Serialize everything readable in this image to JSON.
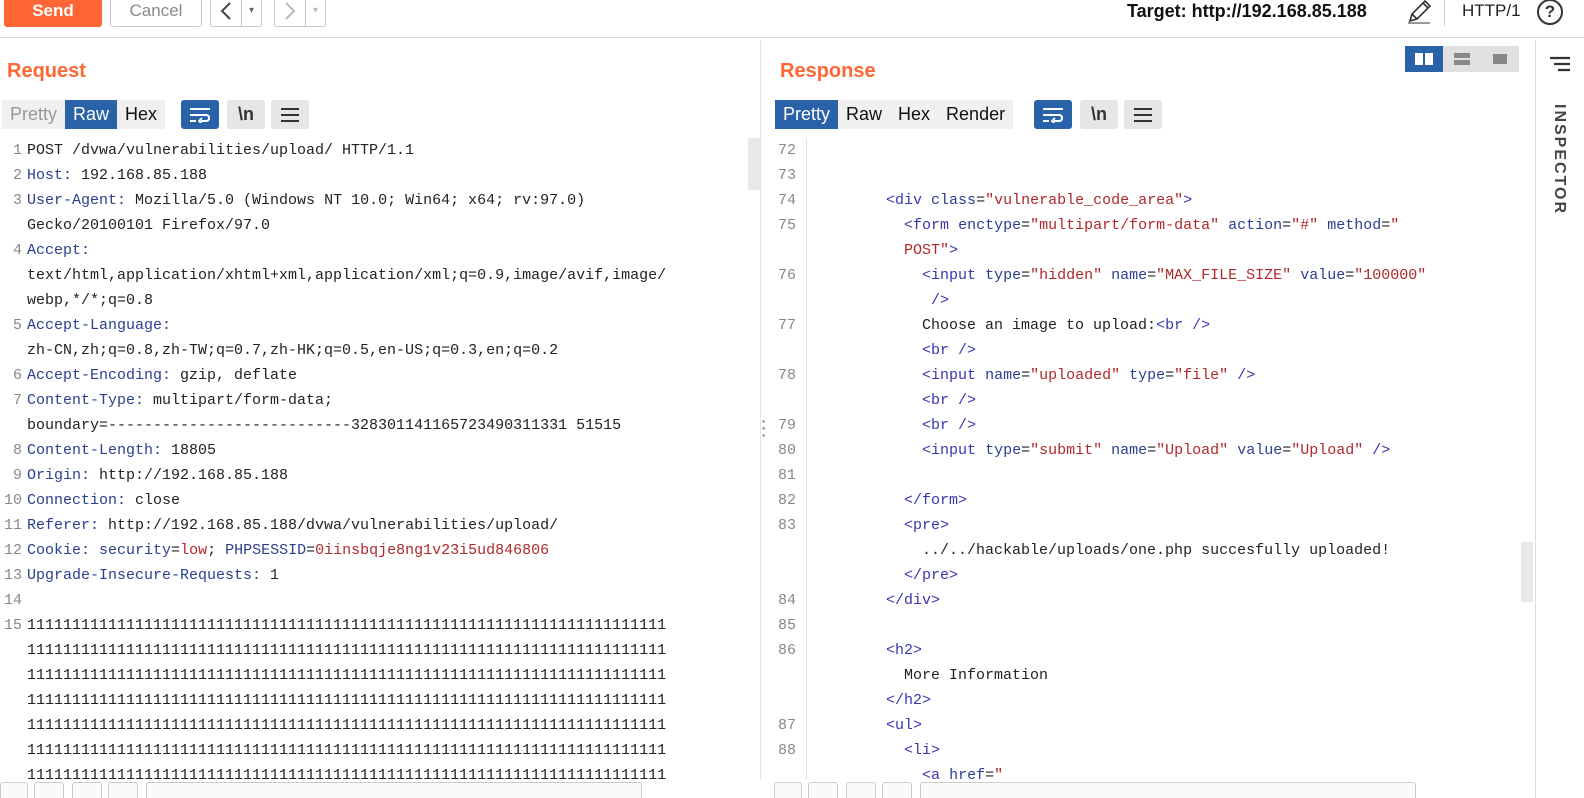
{
  "toolbar": {
    "send_label": "Send",
    "cancel_label": "Cancel",
    "back_glyph": "<",
    "forward_glyph": ">",
    "dropdown_glyph": "▾",
    "target": "Target: http://192.168.85.188",
    "protocol": "HTTP/1",
    "help_glyph": "?"
  },
  "icons": [
    "pencil-icon",
    "help-icon",
    "wrap-icon",
    "newline-icon",
    "menu-icon",
    "layout-split-icon",
    "layout-rows-icon",
    "layout-single-icon",
    "inspector-menu-icon"
  ],
  "colors": {
    "accent": "#ff6633",
    "active_tab": "#2962a8"
  },
  "request": {
    "title": "Request",
    "tabs": [
      {
        "label": "Pretty",
        "active": false
      },
      {
        "label": "Raw",
        "active": true
      },
      {
        "label": "Hex",
        "active": false
      }
    ],
    "newline_label": "\\n",
    "lines": [
      {
        "n": "1",
        "segs": [
          [
            "",
            "POST /dvwa/vulnerabilities/upload/ HTTP/1.1"
          ]
        ]
      },
      {
        "n": "2",
        "segs": [
          [
            "hk",
            "Host:"
          ],
          [
            "",
            " 192.168.85.188"
          ]
        ]
      },
      {
        "n": "3",
        "segs": [
          [
            "hk",
            "User-Agent:"
          ],
          [
            "",
            " Mozilla/5.0 (Windows NT 10.0; Win64; x64; rv:97.0)"
          ]
        ]
      },
      {
        "n": "",
        "segs": [
          [
            "",
            "Gecko/20100101 Firefox/97.0"
          ]
        ]
      },
      {
        "n": "4",
        "segs": [
          [
            "hk",
            "Accept:"
          ]
        ]
      },
      {
        "n": "",
        "segs": [
          [
            "",
            "text/html,application/xhtml+xml,application/xml;q=0.9,image/avif,image/"
          ]
        ]
      },
      {
        "n": "",
        "segs": [
          [
            "",
            "webp,*/*;q=0.8"
          ]
        ]
      },
      {
        "n": "5",
        "segs": [
          [
            "hk",
            "Accept-Language:"
          ]
        ]
      },
      {
        "n": "",
        "segs": [
          [
            "",
            "zh-CN,zh;q=0.8,zh-TW;q=0.7,zh-HK;q=0.5,en-US;q=0.3,en;q=0.2"
          ]
        ]
      },
      {
        "n": "6",
        "segs": [
          [
            "hk",
            "Accept-Encoding:"
          ],
          [
            "",
            " gzip, deflate"
          ]
        ]
      },
      {
        "n": "7",
        "segs": [
          [
            "hk",
            "Content-Type:"
          ],
          [
            "",
            " multipart/form-data;"
          ]
        ]
      },
      {
        "n": "",
        "segs": [
          [
            "",
            "boundary=---------------------------328301141165723490311331 51515"
          ]
        ]
      },
      {
        "n": "8",
        "segs": [
          [
            "hk",
            "Content-Length:"
          ],
          [
            "",
            " 18805"
          ]
        ]
      },
      {
        "n": "9",
        "segs": [
          [
            "hk",
            "Origin:"
          ],
          [
            "",
            " http://192.168.85.188"
          ]
        ]
      },
      {
        "n": "10",
        "segs": [
          [
            "hk",
            "Connection:"
          ],
          [
            "",
            " close"
          ]
        ]
      },
      {
        "n": "11",
        "segs": [
          [
            "hk",
            "Referer:"
          ],
          [
            "",
            " http://192.168.85.188/dvwa/vulnerabilities/upload/"
          ]
        ]
      },
      {
        "n": "12",
        "segs": [
          [
            "hk",
            "Cookie:"
          ],
          [
            "",
            " "
          ],
          [
            "ck",
            "security"
          ],
          [
            "",
            "="
          ],
          [
            "cv",
            "low"
          ],
          [
            "",
            "; "
          ],
          [
            "ck",
            "PHPSESSID"
          ],
          [
            "",
            "="
          ],
          [
            "cv",
            "0iinsbqje8ng1v23i5ud846806"
          ]
        ]
      },
      {
        "n": "13",
        "segs": [
          [
            "hk",
            "Upgrade-Insecure-Requests:"
          ],
          [
            "",
            " 1"
          ]
        ]
      },
      {
        "n": "14",
        "segs": [
          [
            "",
            ""
          ]
        ]
      },
      {
        "n": "15",
        "segs": [
          [
            "",
            "11111111111111111111111111111111111111111111111111111111111111111111111"
          ]
        ]
      },
      {
        "n": "",
        "segs": [
          [
            "",
            "11111111111111111111111111111111111111111111111111111111111111111111111"
          ]
        ]
      },
      {
        "n": "",
        "segs": [
          [
            "",
            "11111111111111111111111111111111111111111111111111111111111111111111111"
          ]
        ]
      },
      {
        "n": "",
        "segs": [
          [
            "",
            "11111111111111111111111111111111111111111111111111111111111111111111111"
          ]
        ]
      },
      {
        "n": "",
        "segs": [
          [
            "",
            "11111111111111111111111111111111111111111111111111111111111111111111111"
          ]
        ]
      },
      {
        "n": "",
        "segs": [
          [
            "",
            "11111111111111111111111111111111111111111111111111111111111111111111111"
          ]
        ]
      },
      {
        "n": "",
        "segs": [
          [
            "",
            "11111111111111111111111111111111111111111111111111111111111111111111111"
          ]
        ]
      }
    ]
  },
  "response": {
    "title": "Response",
    "tabs": [
      {
        "label": "Pretty",
        "active": true
      },
      {
        "label": "Raw",
        "active": false
      },
      {
        "label": "Hex",
        "active": false
      },
      {
        "label": "Render",
        "active": false
      }
    ],
    "newline_label": "\\n",
    "lines": [
      {
        "n": "72",
        "segs": [
          [
            "",
            ""
          ]
        ]
      },
      {
        "n": "73",
        "segs": [
          [
            "",
            ""
          ]
        ]
      },
      {
        "n": "74",
        "segs": [
          [
            "",
            "          "
          ],
          [
            "tg",
            "<div"
          ],
          [
            "",
            " "
          ],
          [
            "an",
            "class"
          ],
          [
            "",
            "="
          ],
          [
            "av",
            "\"vulnerable_code_area\""
          ],
          [
            "tg",
            ">"
          ]
        ]
      },
      {
        "n": "75",
        "segs": [
          [
            "",
            "            "
          ],
          [
            "tg",
            "<form"
          ],
          [
            "",
            " "
          ],
          [
            "an",
            "enctype"
          ],
          [
            "",
            "="
          ],
          [
            "av",
            "\"multipart/form-data\""
          ],
          [
            "",
            " "
          ],
          [
            "an",
            "action"
          ],
          [
            "",
            "="
          ],
          [
            "av",
            "\"#\""
          ],
          [
            "",
            " "
          ],
          [
            "an",
            "method"
          ],
          [
            "",
            "="
          ],
          [
            "av",
            "\""
          ]
        ]
      },
      {
        "n": "",
        "segs": [
          [
            "",
            "            "
          ],
          [
            "av",
            "POST\""
          ],
          [
            "tg",
            ">"
          ]
        ]
      },
      {
        "n": "76",
        "segs": [
          [
            "",
            "              "
          ],
          [
            "tg",
            "<input"
          ],
          [
            "",
            " "
          ],
          [
            "an",
            "type"
          ],
          [
            "",
            "="
          ],
          [
            "av",
            "\"hidden\""
          ],
          [
            "",
            " "
          ],
          [
            "an",
            "name"
          ],
          [
            "",
            "="
          ],
          [
            "av",
            "\"MAX_FILE_SIZE\""
          ],
          [
            "",
            " "
          ],
          [
            "an",
            "value"
          ],
          [
            "",
            "="
          ],
          [
            "av",
            "\"100000\""
          ]
        ]
      },
      {
        "n": "",
        "segs": [
          [
            "",
            "               "
          ],
          [
            "tg",
            "/>"
          ]
        ]
      },
      {
        "n": "77",
        "segs": [
          [
            "",
            "              Choose an image to upload:"
          ],
          [
            "tg",
            "<br />"
          ]
        ]
      },
      {
        "n": "",
        "segs": [
          [
            "",
            "              "
          ],
          [
            "tg",
            "<br />"
          ]
        ]
      },
      {
        "n": "78",
        "segs": [
          [
            "",
            "              "
          ],
          [
            "tg",
            "<input"
          ],
          [
            "",
            " "
          ],
          [
            "an",
            "name"
          ],
          [
            "",
            "="
          ],
          [
            "av",
            "\"uploaded\""
          ],
          [
            "",
            " "
          ],
          [
            "an",
            "type"
          ],
          [
            "",
            "="
          ],
          [
            "av",
            "\"file\""
          ],
          [
            "",
            " "
          ],
          [
            "tg",
            "/>"
          ]
        ]
      },
      {
        "n": "",
        "segs": [
          [
            "",
            "              "
          ],
          [
            "tg",
            "<br />"
          ]
        ]
      },
      {
        "n": "79",
        "segs": [
          [
            "",
            "              "
          ],
          [
            "tg",
            "<br />"
          ]
        ]
      },
      {
        "n": "80",
        "segs": [
          [
            "",
            "              "
          ],
          [
            "tg",
            "<input"
          ],
          [
            "",
            " "
          ],
          [
            "an",
            "type"
          ],
          [
            "",
            "="
          ],
          [
            "av",
            "\"submit\""
          ],
          [
            "",
            " "
          ],
          [
            "an",
            "name"
          ],
          [
            "",
            "="
          ],
          [
            "av",
            "\"Upload\""
          ],
          [
            "",
            " "
          ],
          [
            "an",
            "value"
          ],
          [
            "",
            "="
          ],
          [
            "av",
            "\"Upload\""
          ],
          [
            "",
            " "
          ],
          [
            "tg",
            "/>"
          ]
        ]
      },
      {
        "n": "81",
        "segs": [
          [
            "",
            ""
          ]
        ]
      },
      {
        "n": "82",
        "segs": [
          [
            "",
            "            "
          ],
          [
            "tg",
            "</form>"
          ]
        ]
      },
      {
        "n": "83",
        "segs": [
          [
            "",
            "            "
          ],
          [
            "tg",
            "<pre>"
          ]
        ]
      },
      {
        "n": "",
        "segs": [
          [
            "",
            "              ../../hackable/uploads/one.php succesfully uploaded!"
          ]
        ]
      },
      {
        "n": "",
        "segs": [
          [
            "",
            "            "
          ],
          [
            "tg",
            "</pre>"
          ]
        ]
      },
      {
        "n": "84",
        "segs": [
          [
            "",
            "          "
          ],
          [
            "tg",
            "</div>"
          ]
        ]
      },
      {
        "n": "85",
        "segs": [
          [
            "",
            ""
          ]
        ]
      },
      {
        "n": "86",
        "segs": [
          [
            "",
            "          "
          ],
          [
            "tg",
            "<h2>"
          ]
        ]
      },
      {
        "n": "",
        "segs": [
          [
            "",
            "            More Information"
          ]
        ]
      },
      {
        "n": "",
        "segs": [
          [
            "",
            "          "
          ],
          [
            "tg",
            "</h2>"
          ]
        ]
      },
      {
        "n": "87",
        "segs": [
          [
            "",
            "          "
          ],
          [
            "tg",
            "<ul>"
          ]
        ]
      },
      {
        "n": "88",
        "segs": [
          [
            "",
            "            "
          ],
          [
            "tg",
            "<li>"
          ]
        ]
      },
      {
        "n": "",
        "segs": [
          [
            "",
            "              "
          ],
          [
            "tg",
            "<a"
          ],
          [
            "",
            " "
          ],
          [
            "an",
            "href"
          ],
          [
            "",
            "="
          ],
          [
            "av",
            "\""
          ]
        ]
      }
    ]
  },
  "inspector": {
    "label": "INSPECTOR"
  }
}
